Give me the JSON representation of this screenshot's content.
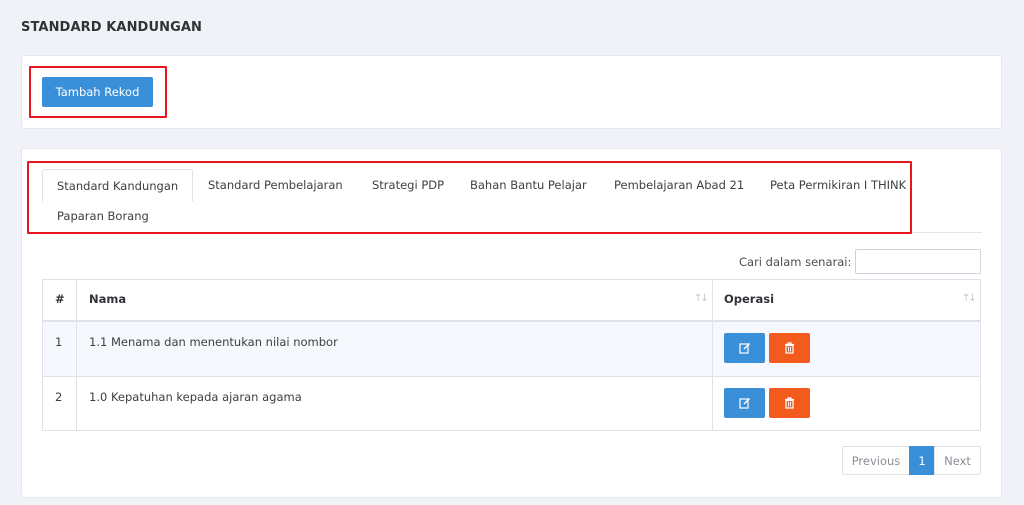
{
  "page": {
    "title": "STANDARD KANDUNGAN"
  },
  "toolbar": {
    "add_label": "Tambah Rekod"
  },
  "tabs": [
    {
      "label": "Standard Kandungan"
    },
    {
      "label": "Standard Pembelajaran"
    },
    {
      "label": "Strategi PDP"
    },
    {
      "label": "Bahan Bantu Pelajar"
    },
    {
      "label": "Pembelajaran Abad 21"
    },
    {
      "label": "Peta Permikiran I THINK"
    },
    {
      "label": "Paparan Borang"
    }
  ],
  "search": {
    "label": "Cari dalam senarai:",
    "value": ""
  },
  "table": {
    "headers": [
      "#",
      "Nama",
      "Operasi"
    ],
    "rows": [
      {
        "no": "1",
        "nama": "1.1 Menama dan menentukan nilai nombor"
      },
      {
        "no": "2",
        "nama": "1.0 Kepatuhan kepada ajaran agama"
      }
    ]
  },
  "pagination": {
    "previous": "Previous",
    "current": "1",
    "next": "Next"
  },
  "colors": {
    "primary": "#3a8fd9",
    "danger": "#f35a1e",
    "highlight": "#e8161e"
  },
  "icons": {
    "edit": "edit-icon",
    "delete": "trash-icon",
    "sort": "sort-icon"
  }
}
